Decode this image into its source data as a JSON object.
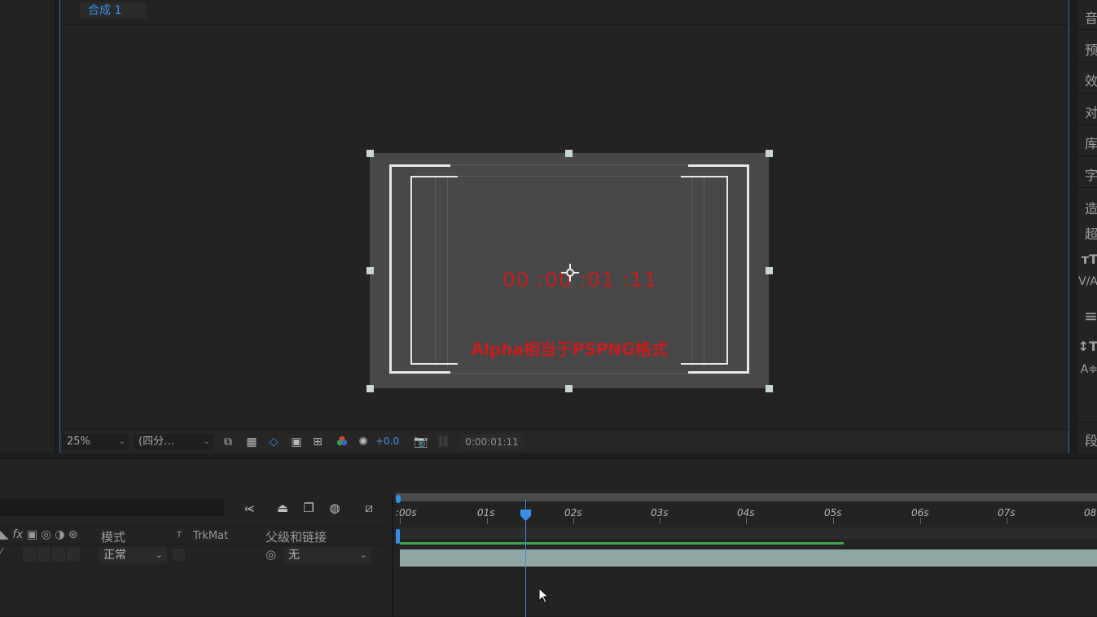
{
  "comp_tab": {
    "label": "合成 1"
  },
  "canvas": {
    "timecode_overlay": "00 :00 :01 :11",
    "alpha_text": "Alpha相当于PSPNG格式"
  },
  "viewer_toolbar": {
    "zoom": "25%",
    "resolution": "(四分…",
    "exposure": "+0.0",
    "current_time": "0:00:01:11"
  },
  "right_panel": {
    "items": [
      "音",
      "预",
      "效",
      "对",
      "库",
      "字",
      "造",
      "超",
      "тT",
      "V/A",
      "≡",
      "↕T",
      "A≑",
      "段"
    ]
  },
  "timeline": {
    "columns": {
      "mode": "模式",
      "t": "T",
      "trkmat": "TrkMat",
      "parent": "父级和链接"
    },
    "layer": {
      "mode_value": "正常",
      "parent_value": "无"
    },
    "ruler_labels": [
      ":00s",
      "01s",
      "02s",
      "03s",
      "04s",
      "05s",
      "06s",
      "07s",
      "08"
    ]
  },
  "colors": {
    "accent": "#3a8ee6",
    "overlay_text": "#c41f1f",
    "work_area": "#3fa34d"
  }
}
